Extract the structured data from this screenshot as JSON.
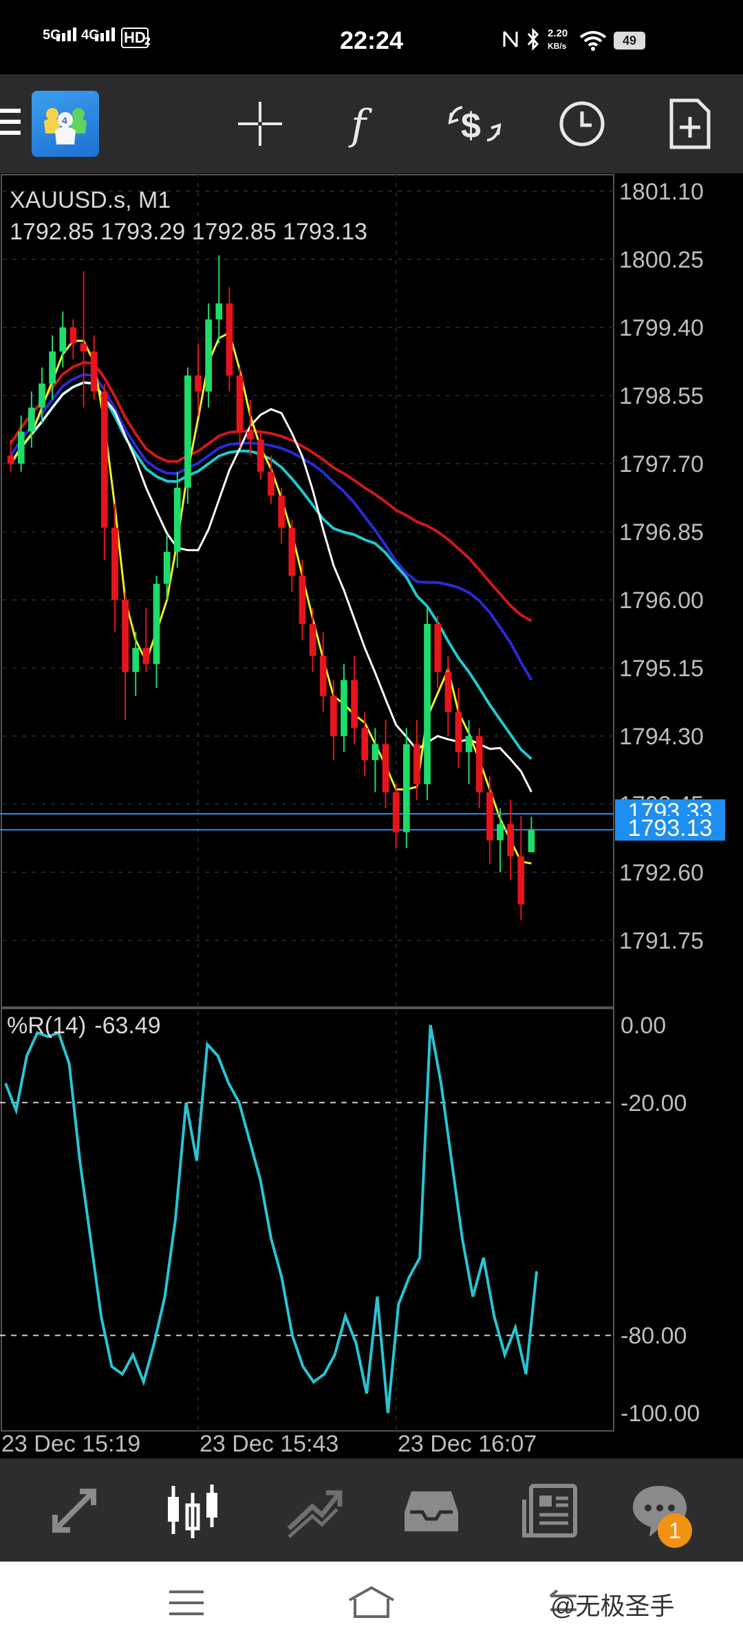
{
  "status_bar": {
    "time": "22:24",
    "network_1": "5G",
    "network_2": "4G",
    "hd_label": "HD",
    "hd_sub": "2",
    "speed_value": "2.20",
    "speed_unit": "KB/s",
    "battery": "49"
  },
  "toolbar": {
    "icons": [
      "menu-icon",
      "metatrader-logo",
      "crosshair-icon",
      "function-icon",
      "trade-icon",
      "clock-icon",
      "new-document-icon"
    ]
  },
  "chart": {
    "symbol_title": "XAUUSD.s, M1",
    "ohlc": "1792.85 1793.29 1792.85 1793.13",
    "price_labels": [
      "1801.10",
      "1800.25",
      "1799.40",
      "1798.55",
      "1797.70",
      "1796.85",
      "1796.00",
      "1795.15",
      "1794.30",
      "1793.45",
      "1792.60",
      "1791.75"
    ],
    "ask_tag": "1793.33",
    "bid_tag": "1793.13",
    "time_labels": [
      "23 Dec 15:19",
      "23 Dec 15:43",
      "23 Dec 16:07"
    ],
    "colors": {
      "bull": "#1edc6a",
      "bear": "#e8141c",
      "ma_fast": "#f0f020",
      "ma_white": "#ffffff",
      "ma_red": "#d01818",
      "ma_blue": "#2a2ad8",
      "ma_cyan": "#20c8d0",
      "wpr": "#28c4d4"
    }
  },
  "indicator": {
    "name": "%R(14)",
    "value": "-63.49",
    "levels": [
      "0.00",
      "-20.00",
      "-80.00",
      "-100.00"
    ]
  },
  "chart_data": {
    "type": "candlestick",
    "title": "XAUUSD.s, M1",
    "ylim": [
      1791.0,
      1801.3
    ],
    "x_labels": [
      "23 Dec 15:19",
      "23 Dec 15:43",
      "23 Dec 16:07"
    ],
    "candles": [
      [
        1797.8,
        1798.0,
        1797.6,
        1797.7
      ],
      [
        1797.7,
        1798.3,
        1797.6,
        1798.1
      ],
      [
        1798.1,
        1798.6,
        1797.9,
        1798.4
      ],
      [
        1798.4,
        1798.9,
        1798.2,
        1798.7
      ],
      [
        1798.7,
        1799.3,
        1798.5,
        1799.1
      ],
      [
        1799.1,
        1799.6,
        1798.9,
        1799.4
      ],
      [
        1799.4,
        1799.5,
        1799.0,
        1799.2
      ],
      [
        1799.2,
        1800.1,
        1798.4,
        1799.1
      ],
      [
        1799.1,
        1799.3,
        1798.5,
        1798.6
      ],
      [
        1798.6,
        1798.7,
        1796.5,
        1796.9
      ],
      [
        1796.9,
        1797.2,
        1795.6,
        1796.0
      ],
      [
        1796.0,
        1796.1,
        1794.5,
        1795.1
      ],
      [
        1795.1,
        1795.6,
        1794.8,
        1795.4
      ],
      [
        1795.4,
        1795.9,
        1795.1,
        1795.2
      ],
      [
        1795.2,
        1796.3,
        1794.9,
        1796.2
      ],
      [
        1796.2,
        1796.8,
        1796.0,
        1796.6
      ],
      [
        1796.6,
        1797.6,
        1796.4,
        1797.4
      ],
      [
        1797.4,
        1798.9,
        1797.2,
        1798.8
      ],
      [
        1798.8,
        1799.2,
        1798.3,
        1798.6
      ],
      [
        1798.6,
        1799.7,
        1798.4,
        1799.5
      ],
      [
        1799.5,
        1800.3,
        1799.2,
        1799.7
      ],
      [
        1799.7,
        1799.9,
        1798.6,
        1798.8
      ],
      [
        1798.8,
        1798.9,
        1797.9,
        1798.1
      ],
      [
        1798.1,
        1798.5,
        1797.8,
        1798.0
      ],
      [
        1798.0,
        1798.1,
        1797.5,
        1797.6
      ],
      [
        1797.6,
        1797.8,
        1797.2,
        1797.3
      ],
      [
        1797.3,
        1797.4,
        1796.7,
        1796.9
      ],
      [
        1796.9,
        1797.0,
        1796.1,
        1796.3
      ],
      [
        1796.3,
        1796.5,
        1795.5,
        1795.7
      ],
      [
        1795.7,
        1795.9,
        1795.1,
        1795.3
      ],
      [
        1795.3,
        1795.6,
        1794.6,
        1794.8
      ],
      [
        1794.8,
        1795.0,
        1794.0,
        1794.3
      ],
      [
        1794.3,
        1795.2,
        1794.1,
        1795.0
      ],
      [
        1795.0,
        1795.3,
        1794.2,
        1794.4
      ],
      [
        1794.4,
        1794.6,
        1793.8,
        1794.0
      ],
      [
        1794.0,
        1794.4,
        1793.6,
        1794.2
      ],
      [
        1794.2,
        1794.5,
        1793.4,
        1793.6
      ],
      [
        1793.6,
        1793.7,
        1792.9,
        1793.1
      ],
      [
        1793.1,
        1794.4,
        1792.9,
        1794.2
      ],
      [
        1794.2,
        1794.5,
        1793.5,
        1793.7
      ],
      [
        1793.7,
        1795.9,
        1793.5,
        1795.7
      ],
      [
        1795.7,
        1795.8,
        1794.9,
        1795.1
      ],
      [
        1795.1,
        1795.3,
        1794.3,
        1794.6
      ],
      [
        1794.6,
        1794.9,
        1793.9,
        1794.1
      ],
      [
        1794.1,
        1794.5,
        1793.7,
        1794.3
      ],
      [
        1794.3,
        1794.4,
        1793.4,
        1793.6
      ],
      [
        1793.6,
        1793.8,
        1792.7,
        1793.0
      ],
      [
        1793.0,
        1793.4,
        1792.6,
        1793.2
      ],
      [
        1793.2,
        1793.5,
        1792.5,
        1792.8
      ],
      [
        1792.8,
        1793.3,
        1792.0,
        1792.2
      ],
      [
        1792.85,
        1793.29,
        1792.85,
        1793.13
      ]
    ],
    "wpr_values": [
      -15,
      -22,
      -8,
      -2,
      -3,
      -2,
      -10,
      -35,
      -55,
      -75,
      -88,
      -90,
      -85,
      -92,
      -82,
      -70,
      -50,
      -20,
      -35,
      -5,
      -8,
      -15,
      -20,
      -30,
      -40,
      -55,
      -65,
      -80,
      -88,
      -92,
      -90,
      -85,
      -75,
      -82,
      -95,
      -70,
      -100,
      -72,
      -65,
      -60,
      0,
      -15,
      -35,
      -55,
      -70,
      -60,
      -75,
      -85,
      -78,
      -90,
      -63.49
    ]
  }
}
